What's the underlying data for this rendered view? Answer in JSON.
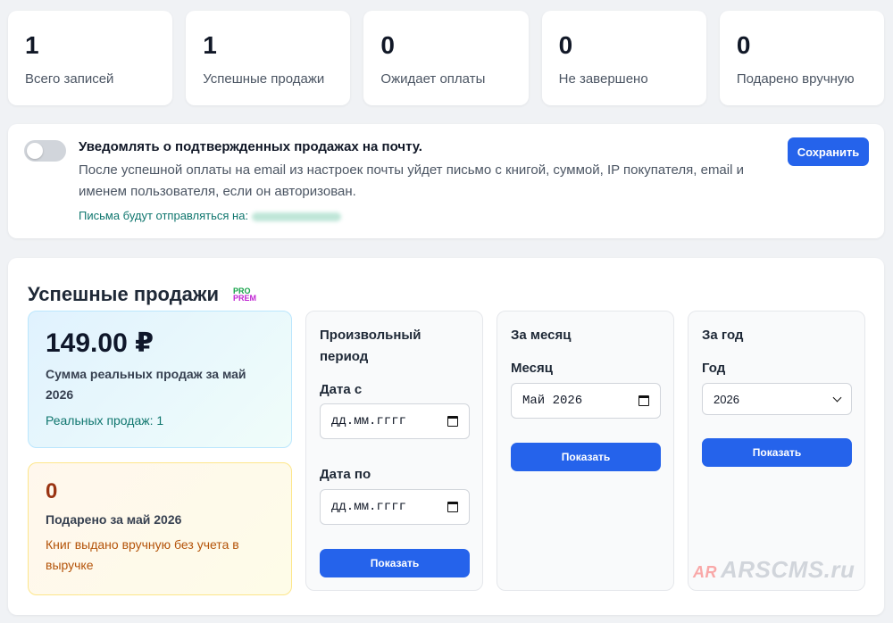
{
  "stats": [
    {
      "value": "1",
      "label": "Всего записей"
    },
    {
      "value": "1",
      "label": "Успешные продажи"
    },
    {
      "value": "0",
      "label": "Ожидает оплаты"
    },
    {
      "value": "0",
      "label": "Не завершено"
    },
    {
      "value": "0",
      "label": "Подарено вручную"
    }
  ],
  "notify": {
    "toggle_on": false,
    "title": "Уведомлять о подтвержденных продажах на почту.",
    "description": "После успешной оплаты на email из настроек почты уйдет письмо с книгой, суммой, IP покупателя, email и именем пользователя, если он авторизован.",
    "email_label": "Письма будут отправляться на:",
    "save_label": "Сохранить"
  },
  "sales": {
    "title": "Успешные продажи",
    "badge_top": "PRO",
    "badge_bottom": "PREM",
    "summary": {
      "amount": "149.00 ₽",
      "title": "Сумма реальных продаж за май 2026",
      "subtitle": "Реальных продаж: 1"
    },
    "gifted": {
      "count": "0",
      "title": "Подарено за май 2026",
      "subtitle": "Книг выдано вручную без учета в выручке"
    },
    "custom_period": {
      "title": "Произвольный период",
      "from_label": "Дата с",
      "from_placeholder": "дд.мм.гггг",
      "to_label": "Дата по",
      "to_placeholder": "дд.мм.гггг",
      "button": "Показать"
    },
    "month_period": {
      "title": "За месяц",
      "field_label": "Месяц",
      "value": "Май 2026",
      "button": "Показать"
    },
    "year_period": {
      "title": "За год",
      "field_label": "Год",
      "value": "2026",
      "button": "Показать"
    }
  },
  "watermark": {
    "logo": "AR",
    "text": "ARSCMS.ru"
  },
  "colors": {
    "accent": "#2563eb",
    "success_text": "#0f766e",
    "gift_text": "#9a3412"
  }
}
